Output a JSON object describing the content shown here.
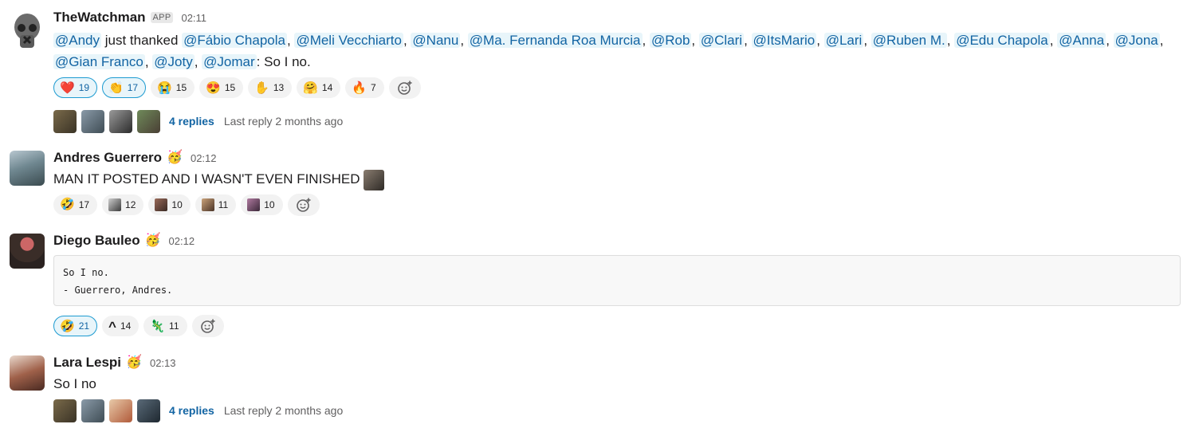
{
  "messages": {
    "watchman": {
      "name": "TheWatchman",
      "badge": "APP",
      "time": "02:11",
      "actor": "@Andy",
      "thanked_text": " just thanked ",
      "mentions": [
        "@Fábio Chapola",
        "@Meli Vecchiarto",
        "@Nanu",
        "@Ma. Fernanda Roa Murcia",
        "@Rob",
        "@Clari",
        "@ItsMario",
        "@Lari",
        "@Ruben M.",
        "@Edu Chapola",
        "@Anna",
        "@Jona",
        "@Gian Franco",
        "@Joty",
        "@Jomar"
      ],
      "separator": ",",
      "closing": ": So I no.",
      "reactions": [
        {
          "emoji": "❤️",
          "icon": "heart-icon",
          "count": "19",
          "mine": true
        },
        {
          "emoji": "👏",
          "icon": "clap-icon",
          "count": "17",
          "mine": true
        },
        {
          "emoji": "😭",
          "icon": "crying-icon",
          "count": "15"
        },
        {
          "emoji": "😍",
          "icon": "heart-eyes-icon",
          "count": "15"
        },
        {
          "emoji": "✋",
          "icon": "wave-hand-icon",
          "count": "13"
        },
        {
          "emoji": "🤗",
          "icon": "hug-icon",
          "count": "14"
        },
        {
          "emoji": "🔥",
          "icon": "fire-image-icon",
          "count": "7"
        }
      ],
      "thread": {
        "replies": "4 replies",
        "last_reply": "Last reply 2 months ago"
      }
    },
    "andres": {
      "name": "Andres Guerrero",
      "status_emoji": "🥳",
      "time": "02:12",
      "text": "MAN IT POSTED AND I WASN'T EVEN FINISHED",
      "reactions": [
        {
          "emoji": "🤣",
          "icon": "rofl-icon",
          "count": "17"
        },
        {
          "icon": "custom-emoji-icon",
          "count": "12"
        },
        {
          "icon": "custom-face-icon",
          "count": "10"
        },
        {
          "icon": "custom-face-icon",
          "count": "11"
        },
        {
          "icon": "custom-face-icon",
          "count": "10"
        }
      ]
    },
    "diego": {
      "name": "Diego Bauleo",
      "status_emoji": "🥳",
      "time": "02:12",
      "code_lines": [
        "So I no.",
        "- Guerrero, Andres."
      ],
      "reactions": [
        {
          "emoji": "🤣",
          "icon": "rofl-icon",
          "count": "21",
          "mine": true
        },
        {
          "emoji": "^",
          "icon": "caret-up-icon",
          "count": "14"
        },
        {
          "emoji": "🦎",
          "icon": "lizard-icon",
          "count": "11"
        }
      ]
    },
    "lara": {
      "name": "Lara Lespi",
      "status_emoji": "🥳",
      "time": "02:13",
      "text": "So I no",
      "thread": {
        "replies": "4 replies",
        "last_reply": "Last reply 2 months ago"
      }
    }
  },
  "colors": {
    "link": "#1264a3",
    "mention_bg": "#e8f5fa",
    "reaction_bg": "#f2f2f2",
    "reaction_mine_border": "#1d9bd1"
  }
}
